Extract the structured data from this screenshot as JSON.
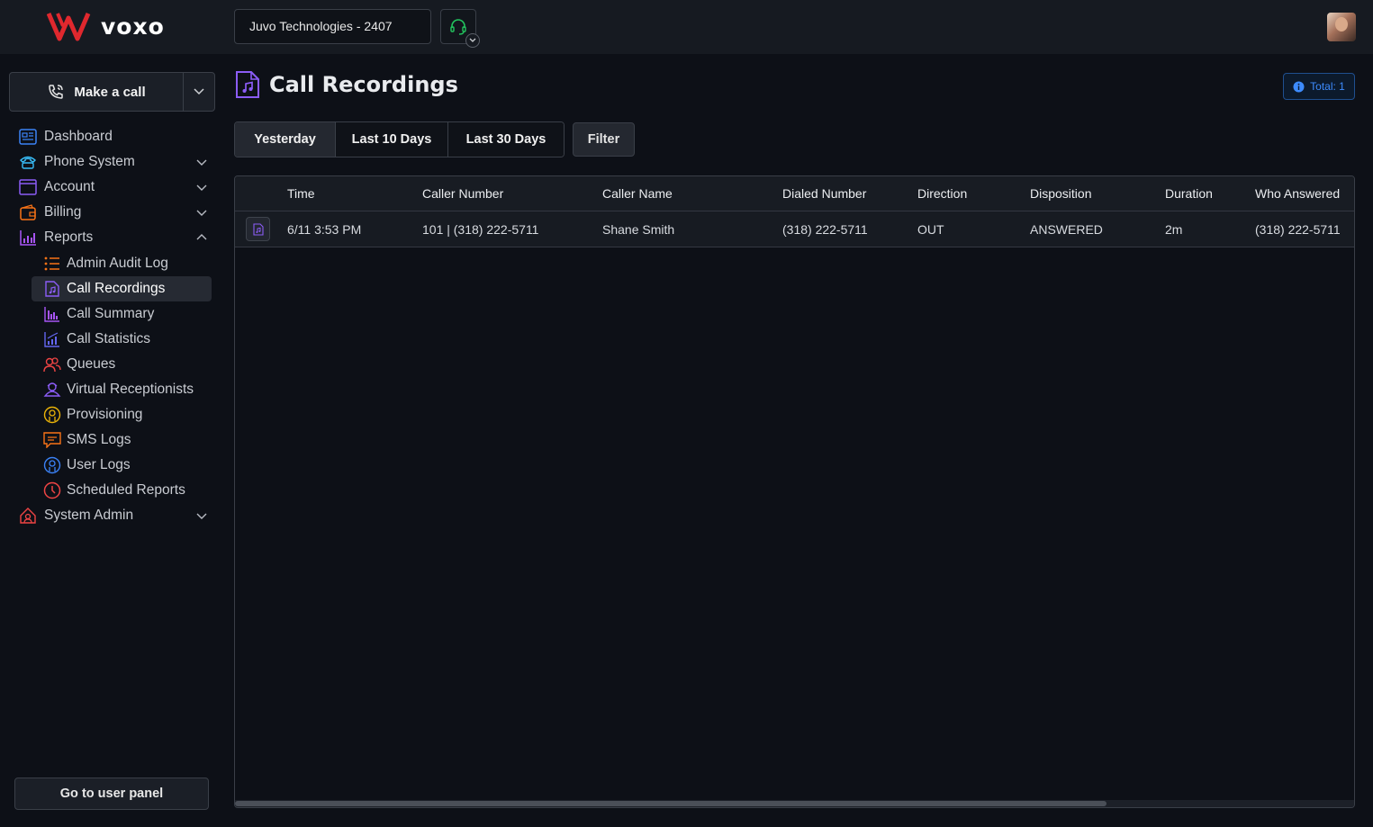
{
  "brand": {
    "name": "voxo"
  },
  "topbar": {
    "account_selector": "Juvo Technologies - 2407"
  },
  "sidebar": {
    "make_call_label": "Make a call",
    "items": [
      {
        "label": "Dashboard",
        "icon": "dashboard-icon"
      },
      {
        "label": "Phone System",
        "icon": "phone-system-icon"
      },
      {
        "label": "Account",
        "icon": "account-icon"
      },
      {
        "label": "Billing",
        "icon": "wallet-icon"
      },
      {
        "label": "Reports",
        "icon": "reports-chart-icon"
      },
      {
        "label": "System Admin",
        "icon": "system-admin-icon"
      }
    ],
    "reports_sub": [
      {
        "label": "Admin Audit Log",
        "icon": "list-icon"
      },
      {
        "label": "Call Recordings",
        "icon": "music-file-icon"
      },
      {
        "label": "Call Summary",
        "icon": "bar-chart-icon"
      },
      {
        "label": "Call Statistics",
        "icon": "statistics-icon"
      },
      {
        "label": "Queues",
        "icon": "people-icon"
      },
      {
        "label": "Virtual Receptionists",
        "icon": "receptionist-icon"
      },
      {
        "label": "Provisioning",
        "icon": "provisioning-icon"
      },
      {
        "label": "SMS Logs",
        "icon": "sms-icon"
      },
      {
        "label": "User Logs",
        "icon": "user-icon"
      },
      {
        "label": "Scheduled Reports",
        "icon": "clock-icon"
      }
    ],
    "user_panel_label": "Go to user panel"
  },
  "main": {
    "title": "Call Recordings",
    "total_badge": "Total: 1",
    "tabs": [
      "Yesterday",
      "Last 10 Days",
      "Last 30 Days"
    ],
    "filter_label": "Filter",
    "table": {
      "headers": [
        "Time",
        "Caller Number",
        "Caller Name",
        "Dialed Number",
        "Direction",
        "Disposition",
        "Duration",
        "Who Answered"
      ],
      "rows": [
        [
          "6/11 3:53 PM",
          "101 | (318) 222-5711",
          "Shane Smith",
          "(318) 222-5711",
          "OUT",
          "ANSWERED",
          "2m",
          "(318) 222-5711"
        ]
      ]
    }
  },
  "colors": {
    "accent_red": "#e0282e",
    "accent_purple": "#8b5cf6",
    "badge_blue": "#3d8bfd",
    "headset_green": "#22c55e"
  }
}
